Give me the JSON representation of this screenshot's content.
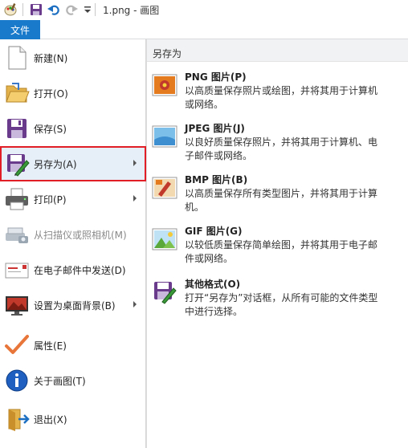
{
  "window": {
    "title": "1.png - 画图"
  },
  "quick_access": {
    "icons": [
      "paint-app-icon",
      "save-icon",
      "undo-icon",
      "redo-icon",
      "customize-dropdown-icon"
    ]
  },
  "file_tab": {
    "label": "文件"
  },
  "menu": {
    "items": [
      {
        "label": "新建(N)",
        "icon": "new-file-icon"
      },
      {
        "label": "打开(O)",
        "icon": "open-folder-icon"
      },
      {
        "label": "保存(S)",
        "icon": "save-icon"
      },
      {
        "label": "另存为(A)",
        "icon": "save-as-icon",
        "selected": true,
        "submenu": true
      },
      {
        "label": "打印(P)",
        "icon": "print-icon",
        "submenu": true
      },
      {
        "label": "从扫描仪或照相机(M)",
        "icon": "scanner-icon",
        "disabled": true
      },
      {
        "label": "在电子邮件中发送(D)",
        "icon": "email-icon"
      },
      {
        "label": "设置为桌面背景(B)",
        "icon": "desktop-background-icon",
        "submenu": true
      },
      {
        "label": "属性(E)",
        "icon": "properties-checkmark-icon"
      },
      {
        "label": "关于画图(T)",
        "icon": "info-icon"
      },
      {
        "label": "退出(X)",
        "icon": "exit-icon"
      }
    ]
  },
  "submenu": {
    "header": "另存为",
    "items": [
      {
        "title": "PNG 图片(P)",
        "description": "以高质量保存照片或绘图，并将其用于计算机或网络。",
        "icon": "png-image-icon"
      },
      {
        "title": "JPEG 图片(J)",
        "description": "以良好质量保存照片，并将其用于计算机、电子邮件或网络。",
        "icon": "jpeg-image-icon"
      },
      {
        "title": "BMP 图片(B)",
        "description": "以高质量保存所有类型图片，并将其用于计算机。",
        "icon": "bmp-image-icon"
      },
      {
        "title": "GIF 图片(G)",
        "description": "以较低质量保存简单绘图，并将其用于电子邮件或网络。",
        "icon": "gif-image-icon"
      },
      {
        "title": "其他格式(O)",
        "description": "打开“另存为”对话框，从所有可能的文件类型中进行选择。",
        "icon": "other-formats-icon"
      }
    ]
  },
  "colors": {
    "accent": "#1979ca",
    "selection_border": "#e11d26",
    "selection_fill": "#e6eff8"
  }
}
